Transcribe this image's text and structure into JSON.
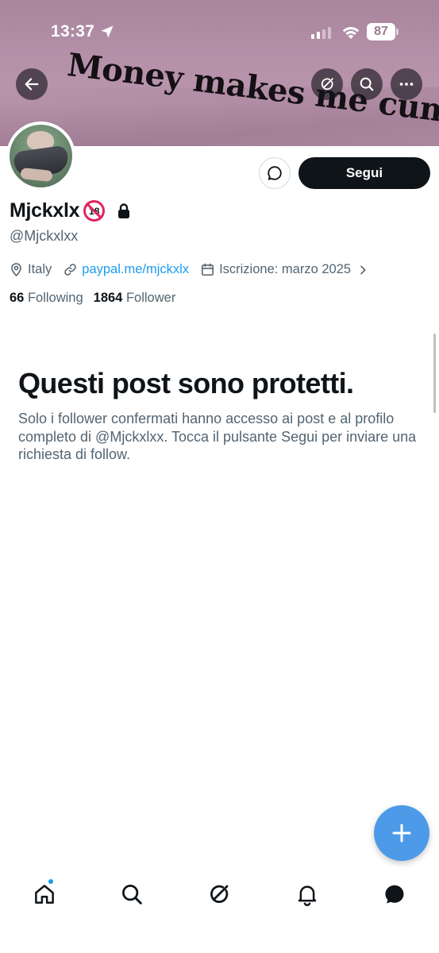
{
  "status_bar": {
    "time": "13:37",
    "battery": "87"
  },
  "banner": {
    "text": "Money makes me cum"
  },
  "actions": {
    "follow_label": "Segui"
  },
  "profile": {
    "display_name": "Mjckxlx",
    "badge": "18",
    "handle": "@Mjckxlxx",
    "location": "Italy",
    "link": "paypal.me/mjckxlx",
    "joined": "Iscrizione: marzo 2025",
    "following_count": "66",
    "following_label": "Following",
    "followers_count": "1864",
    "followers_label": "Follower"
  },
  "protected": {
    "title": "Questi post sono protetti.",
    "description": "Solo i follower confermati hanno accesso ai post e al profilo completo di @Mjckxlxx. Tocca il pulsante Segui per inviare una richiesta di follow."
  },
  "icons": {
    "back": "back-arrow-icon",
    "grok": "grok-icon",
    "search": "search-icon",
    "more": "more-icon",
    "message": "message-icon",
    "compose": "plus-icon",
    "tabs": [
      "home-icon",
      "search-icon",
      "grok-icon",
      "bell-icon",
      "messages-icon"
    ]
  },
  "colors": {
    "accent": "#1d9bf0",
    "fab": "#4d9be8",
    "text_primary": "#0f1419",
    "text_secondary": "#536471",
    "follow_button": "#0f1419",
    "banner": "#b893ab"
  }
}
